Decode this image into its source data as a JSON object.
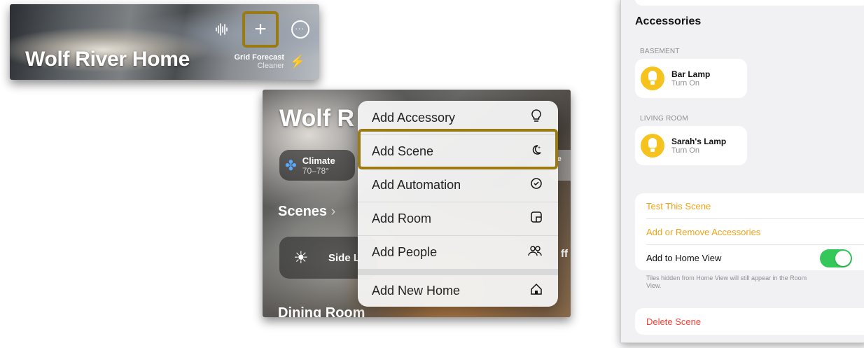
{
  "panel1": {
    "title": "Wolf River Home",
    "plus_label": "+",
    "grid_forecast": {
      "title": "Grid Forecast",
      "subtitle": "Cleaner"
    }
  },
  "panel2": {
    "bg_title": "Wolf R",
    "climate_chip": {
      "title": "Climate",
      "range": "70–78°"
    },
    "right_chip_text": "pe",
    "right_chip_sub": "Pl",
    "scenes_label": "Scenes",
    "scenes_chevron": "›",
    "scene_tile_label": "Side L",
    "right_edge_text": "ff",
    "dining_label": "Dining Room",
    "menu": [
      {
        "label": "Add Accessory",
        "icon": "lightbulb-icon",
        "glyph": "💡"
      },
      {
        "label": "Add Scene",
        "icon": "scene-icon",
        "glyph": "☾"
      },
      {
        "label": "Add Automation",
        "icon": "clock-icon",
        "glyph": "⏲"
      },
      {
        "label": "Add Room",
        "icon": "room-icon",
        "glyph": "▣"
      },
      {
        "label": "Add People",
        "icon": "people-icon",
        "glyph": "👥"
      },
      {
        "label": "Add New Home",
        "icon": "home-icon",
        "glyph": "⌂"
      }
    ]
  },
  "panel3": {
    "accessories_title": "Accessories",
    "sections": [
      {
        "label": "BASEMENT",
        "item": {
          "title": "Bar Lamp",
          "subtitle": "Turn On"
        }
      },
      {
        "label": "LIVING ROOM",
        "item": {
          "title": "Sarah's Lamp",
          "subtitle": "Turn On"
        }
      }
    ],
    "test_scene": "Test This Scene",
    "add_remove": "Add or Remove Accessories",
    "add_home_view": "Add to Home View",
    "toggle_on": true,
    "footnote": "Tiles hidden from Home View will still appear in the Room View.",
    "delete_scene": "Delete Scene"
  },
  "colors": {
    "accent_orange": "#f0a318",
    "destructive": "#ff3b30",
    "toggle_green": "#34c759",
    "highlight_box": "#9a7a12",
    "bulb_yellow": "#f6c21d"
  }
}
